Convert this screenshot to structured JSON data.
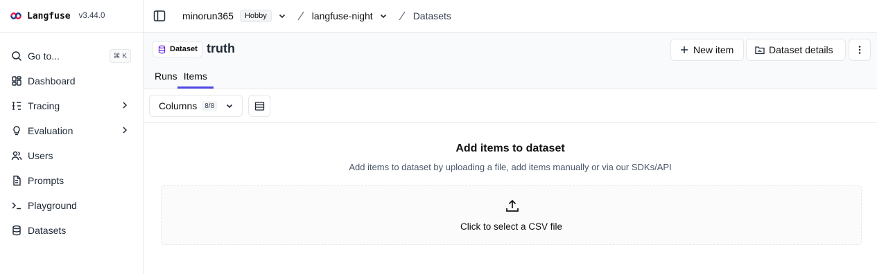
{
  "app": {
    "name": "Langfuse",
    "version": "v3.44.0"
  },
  "sidebar": {
    "goto": {
      "label": "Go to...",
      "shortcut": "⌘ K"
    },
    "items": [
      {
        "label": "Dashboard",
        "icon": "dashboard-icon"
      },
      {
        "label": "Tracing",
        "icon": "tracing-icon",
        "has_children": true
      },
      {
        "label": "Evaluation",
        "icon": "lightbulb-icon",
        "has_children": true
      },
      {
        "label": "Users",
        "icon": "users-icon"
      },
      {
        "label": "Prompts",
        "icon": "prompts-icon"
      },
      {
        "label": "Playground",
        "icon": "terminal-icon"
      },
      {
        "label": "Datasets",
        "icon": "database-icon"
      }
    ]
  },
  "topbar": {
    "org": "minorun365",
    "plan": "Hobby",
    "project": "langfuse-night",
    "page": "Datasets"
  },
  "header": {
    "type_badge": "Dataset",
    "title": "truth",
    "new_item_label": "New item",
    "details_label": "Dataset details",
    "tabs": [
      {
        "label": "Runs"
      },
      {
        "label": "Items",
        "active": true
      }
    ]
  },
  "toolbar": {
    "columns_label": "Columns",
    "columns_count": "8/8"
  },
  "empty_state": {
    "title": "Add items to dataset",
    "description": "Add items to dataset by uploading a file, add items manually or via our SDKs/API",
    "upload_label": "Click to select a CSV file"
  },
  "colors": {
    "accent": "#4f46e5",
    "border": "#e5e7eb",
    "header_bg": "#f9fafb"
  }
}
